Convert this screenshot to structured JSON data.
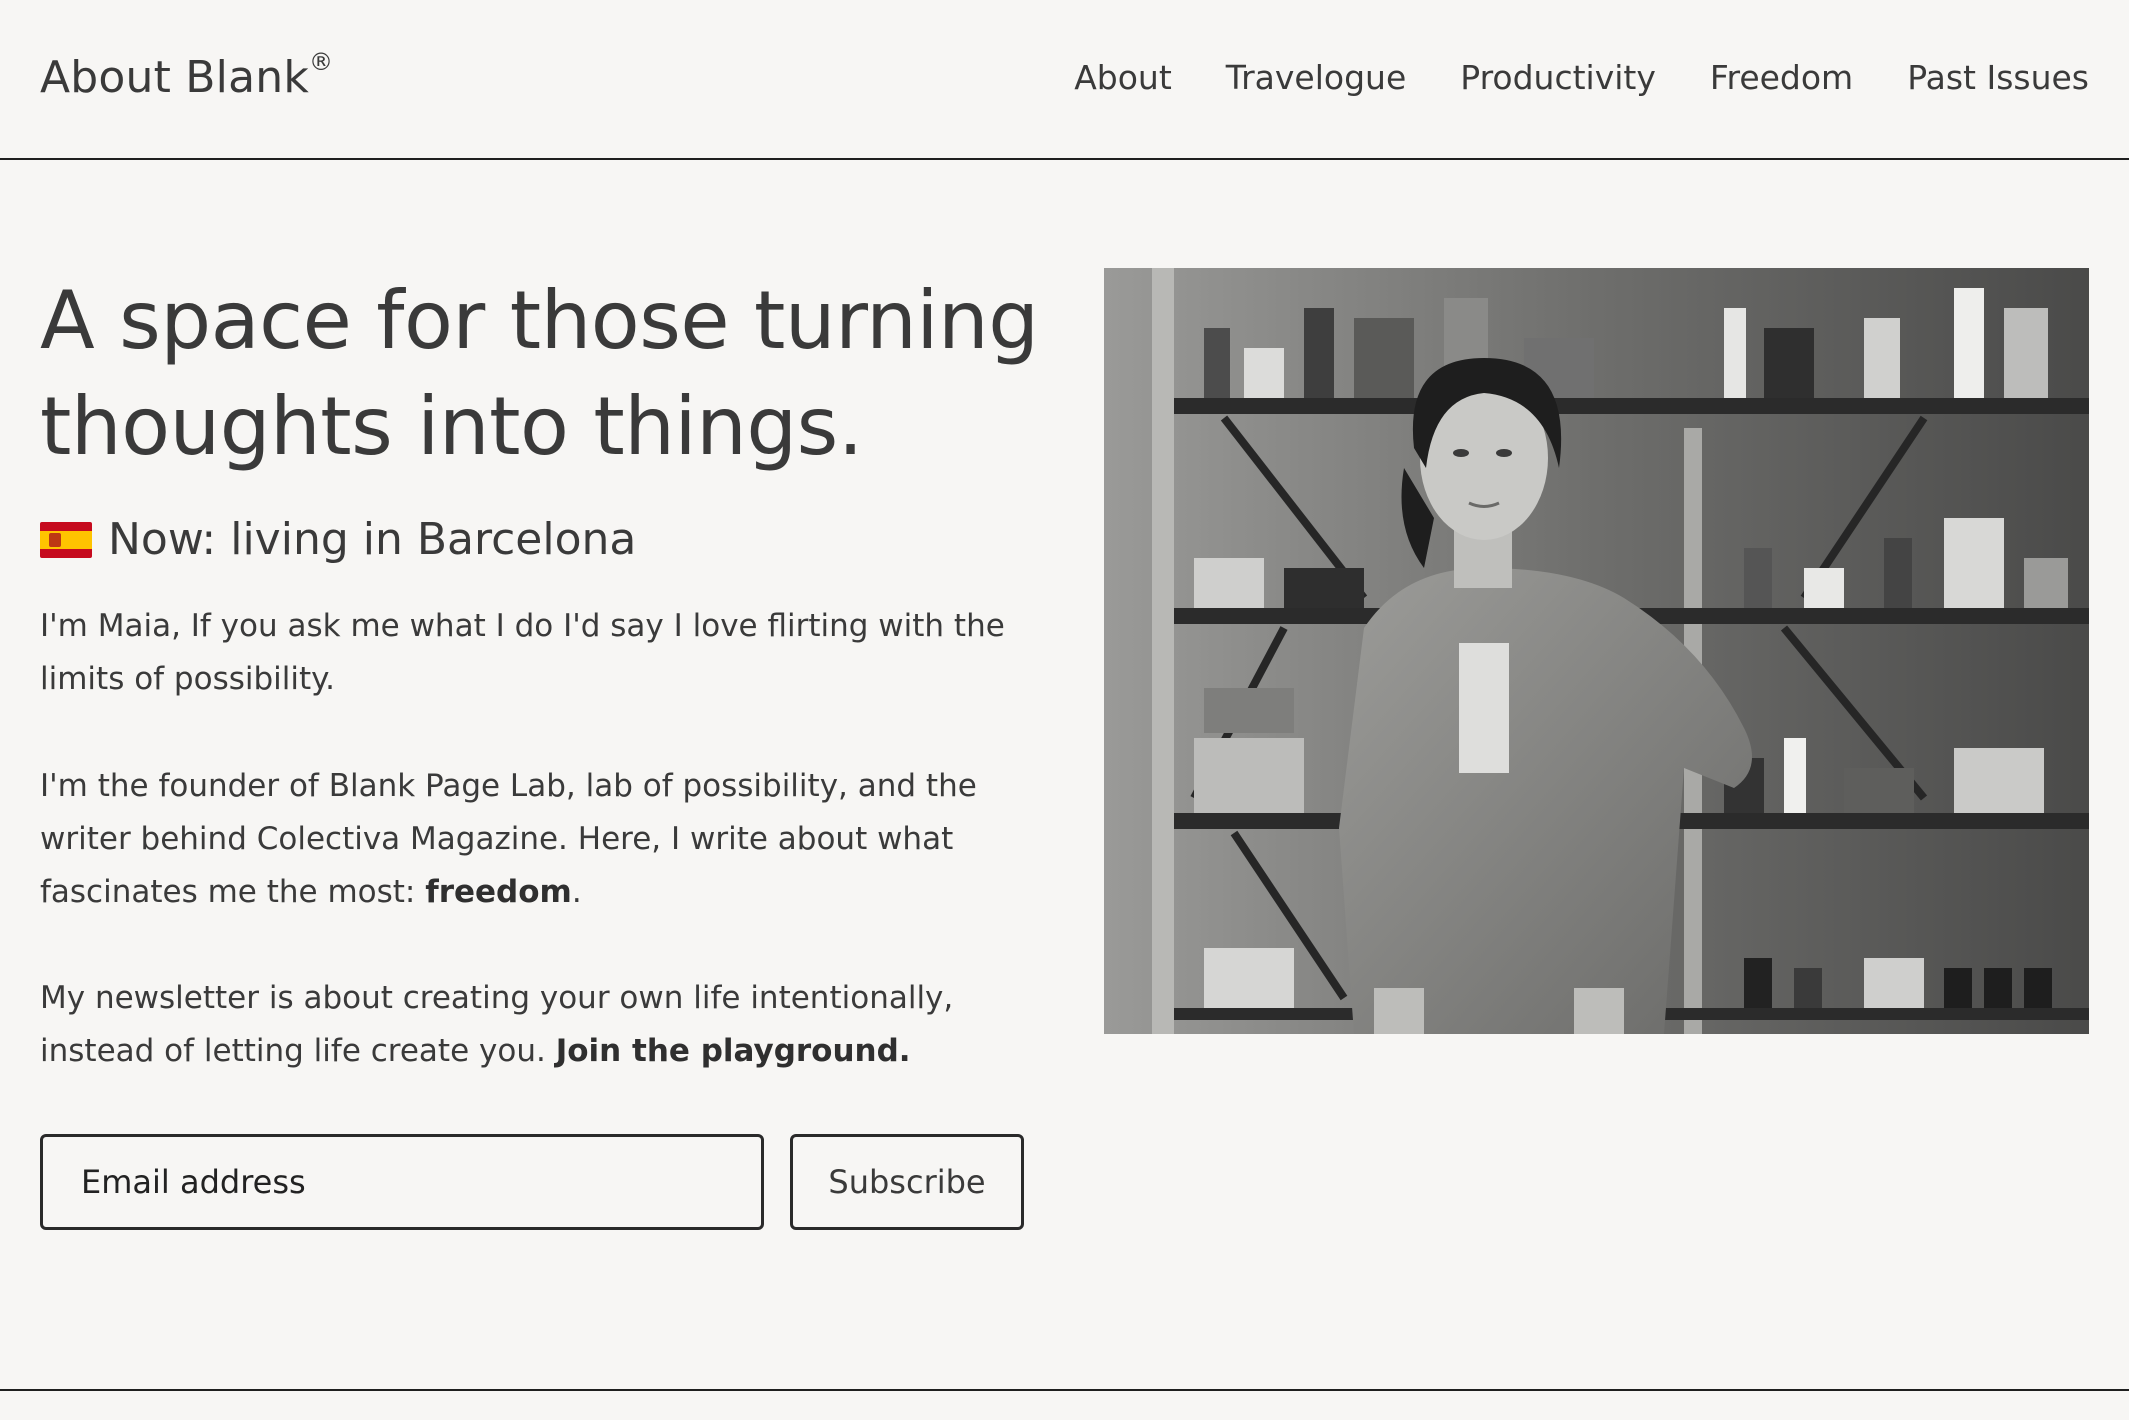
{
  "header": {
    "brand": "About Blank",
    "brand_mark": "®",
    "nav": [
      "About",
      "Travelogue",
      "Productivity",
      "Freedom",
      "Past Issues"
    ]
  },
  "hero": {
    "title": "A space for those turning thoughts into things.",
    "flag_icon": "spain-flag-icon",
    "now_line": "Now: living in Barcelona"
  },
  "intro": {
    "p1": "I'm Maia, If you ask me what I do I'd say I love flirting with the limits of possibility.",
    "p2_text": "I'm the founder of Blank Page Lab, lab of possibility, and the writer behind Colectiva Magazine. Here, I write about what fascinates me the most: ",
    "p2_bold": "freedom",
    "p2_end": ".",
    "p3_text": "My newsletter is about creating your own life intentionally, instead of letting life create you. ",
    "p3_bold": "Join the playground."
  },
  "subscribe": {
    "email_placeholder": "Email address",
    "button_label": "Subscribe"
  },
  "colors": {
    "background": "#f7f6f4",
    "text": "#3a3a3a",
    "border": "#1f1f1f"
  }
}
